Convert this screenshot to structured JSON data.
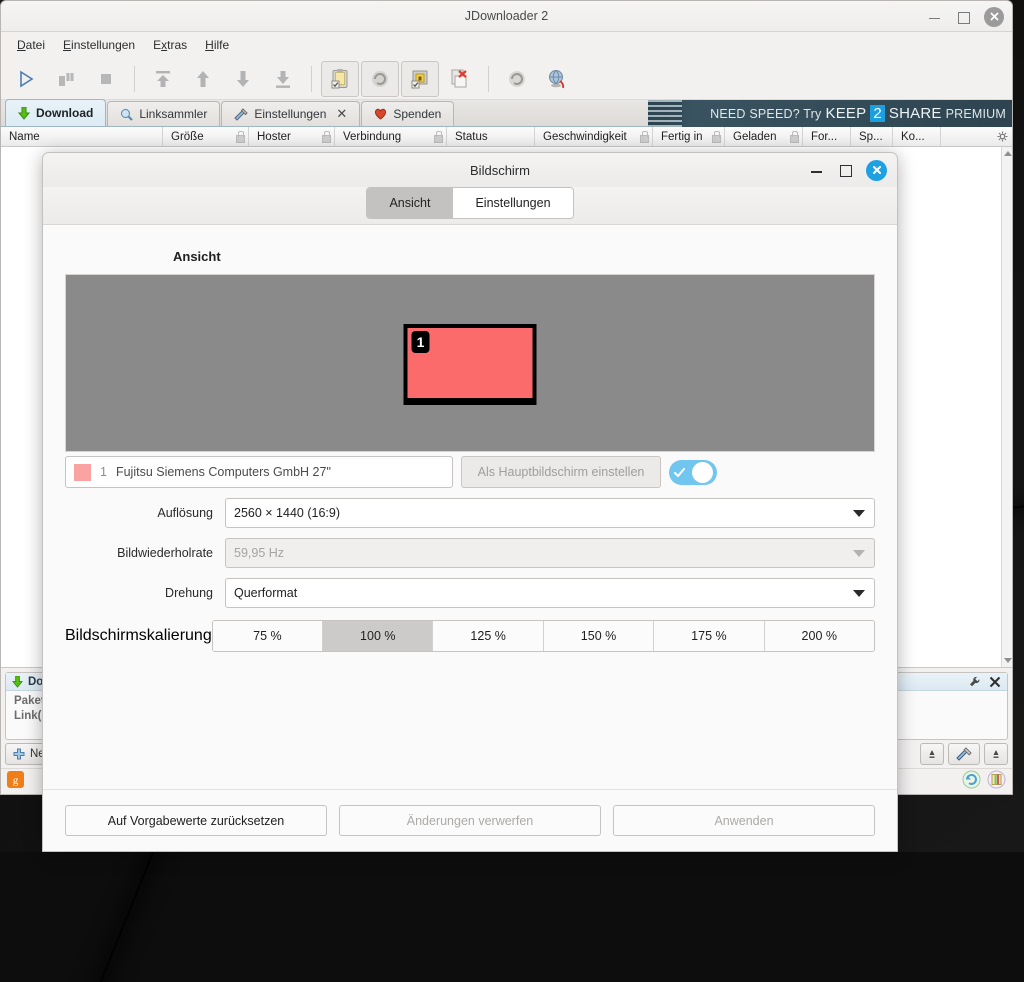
{
  "desktop": {
    "background_color": "#121212"
  },
  "app_window": {
    "title": "JDownloader 2",
    "controls": {
      "minimize": "minimize-window",
      "maximize": "maximize-window",
      "close": "close-window"
    },
    "menubar": [
      {
        "label": "Datei",
        "mnemonic": "D"
      },
      {
        "label": "Einstellungen",
        "mnemonic": "E"
      },
      {
        "label": "Extras",
        "mnemonic": "x"
      },
      {
        "label": "Hilfe",
        "mnemonic": "H"
      }
    ],
    "toolbar": [
      {
        "name": "start-downloads-icon",
        "glyph": "play"
      },
      {
        "name": "pause-downloads-icon",
        "glyph": "pause"
      },
      {
        "name": "stop-downloads-icon",
        "glyph": "stop"
      },
      {
        "name": "move-to-top-icon",
        "glyph": "top"
      },
      {
        "name": "move-up-icon",
        "glyph": "up"
      },
      {
        "name": "move-down-icon",
        "glyph": "down"
      },
      {
        "name": "move-to-bottom-icon",
        "glyph": "bottom"
      },
      {
        "name": "clipboard-monitor-icon",
        "glyph": "clipboard"
      },
      {
        "name": "reconnect-icon",
        "glyph": "reconnect"
      },
      {
        "name": "premium-accounts-icon",
        "glyph": "lock"
      },
      {
        "name": "delete-finished-icon",
        "glyph": "delete"
      },
      {
        "name": "refresh-icon",
        "glyph": "refresh"
      },
      {
        "name": "global-settings-icon",
        "glyph": "globe"
      }
    ],
    "tabs": [
      {
        "label": "Download",
        "icon": "download-arrow-icon",
        "active": true,
        "closable": false
      },
      {
        "label": "Linksammler",
        "icon": "magnifier-icon",
        "active": false,
        "closable": false
      },
      {
        "label": "Einstellungen",
        "icon": "tools-icon",
        "active": false,
        "closable": true
      },
      {
        "label": "Spenden",
        "icon": "heart-icon",
        "active": false,
        "closable": false
      }
    ],
    "banner": {
      "part1": "NEED SPEED? Try",
      "part2": "KEEP",
      "highlight": "2",
      "part3": "SHARE",
      "part4": "PREMIUM",
      "highlight_color": "#1a9fe0"
    },
    "table": {
      "columns": [
        {
          "label": "Name",
          "width": 162,
          "lock": false
        },
        {
          "label": "Größe",
          "width": 86,
          "lock": true
        },
        {
          "label": "Hoster",
          "width": 86,
          "lock": true
        },
        {
          "label": "Verbindung",
          "width": 112,
          "lock": true
        },
        {
          "label": "Status",
          "width": 88,
          "lock": false
        },
        {
          "label": "Geschwindigkeit",
          "width": 118,
          "lock": true
        },
        {
          "label": "Fertig in",
          "width": 72,
          "lock": true
        },
        {
          "label": "Geladen",
          "width": 78,
          "lock": true
        },
        {
          "label": "For...",
          "width": 48,
          "lock": false
        },
        {
          "label": "Sp...",
          "width": 42,
          "lock": false
        },
        {
          "label": "Ko...",
          "width": 48,
          "lock": false
        }
      ],
      "rows": []
    },
    "info_panel": {
      "header": "Downloads",
      "header_icon": "download-arrow-icon",
      "tools": [
        "wrench-icon",
        "close-icon"
      ],
      "line1": "Pakete:",
      "line2": "Link(s):"
    },
    "bottom_strip": {
      "new_package_label": "Neues Paket",
      "new_package_icon": "plus-icon",
      "settings_icon": "tools-icon"
    },
    "status_bar": {
      "icons": [
        "jdownloader-logo-icon",
        "update-icon",
        "extract-icon"
      ]
    }
  },
  "dialog": {
    "title": "Bildschirm",
    "controls": {
      "minimize": "minimize-dialog",
      "maximize": "maximize-dialog",
      "close": "close-dialog",
      "close_color": "#1fa0e0"
    },
    "tabs": [
      {
        "label": "Ansicht",
        "selected": true
      },
      {
        "label": "Einstellungen",
        "selected": false
      }
    ],
    "section_title": "Ansicht",
    "preview": {
      "background_color": "#8a8a8a",
      "monitor_color": "#fb6b6b",
      "monitor_badge": "1"
    },
    "monitor_select": {
      "number": "1",
      "name": "Fujitsu Siemens Computers GmbH 27\"",
      "swatch_color": "#fba3a3"
    },
    "set_primary_button": {
      "label": "Als Hauptbildschirm einstellen",
      "enabled": false
    },
    "enabled_toggle": {
      "state": "on",
      "color": "#70c6ef"
    },
    "fields": [
      {
        "label": "Auflösung",
        "value": "2560 × 1440 (16:9)",
        "enabled": true
      },
      {
        "label": "Bildwiederholrate",
        "value": "59,95 Hz",
        "enabled": false
      },
      {
        "label": "Drehung",
        "value": "Querformat",
        "enabled": true
      }
    ],
    "scaling": {
      "label": "Bildschirmskalierung",
      "options": [
        "75 %",
        "100 %",
        "125 %",
        "150 %",
        "175 %",
        "200 %"
      ],
      "selected": "100 %"
    },
    "footer_buttons": [
      {
        "label": "Auf Vorgabewerte zurücksetzen",
        "enabled": true
      },
      {
        "label": "Änderungen verwerfen",
        "enabled": false
      },
      {
        "label": "Anwenden",
        "enabled": false
      }
    ]
  }
}
